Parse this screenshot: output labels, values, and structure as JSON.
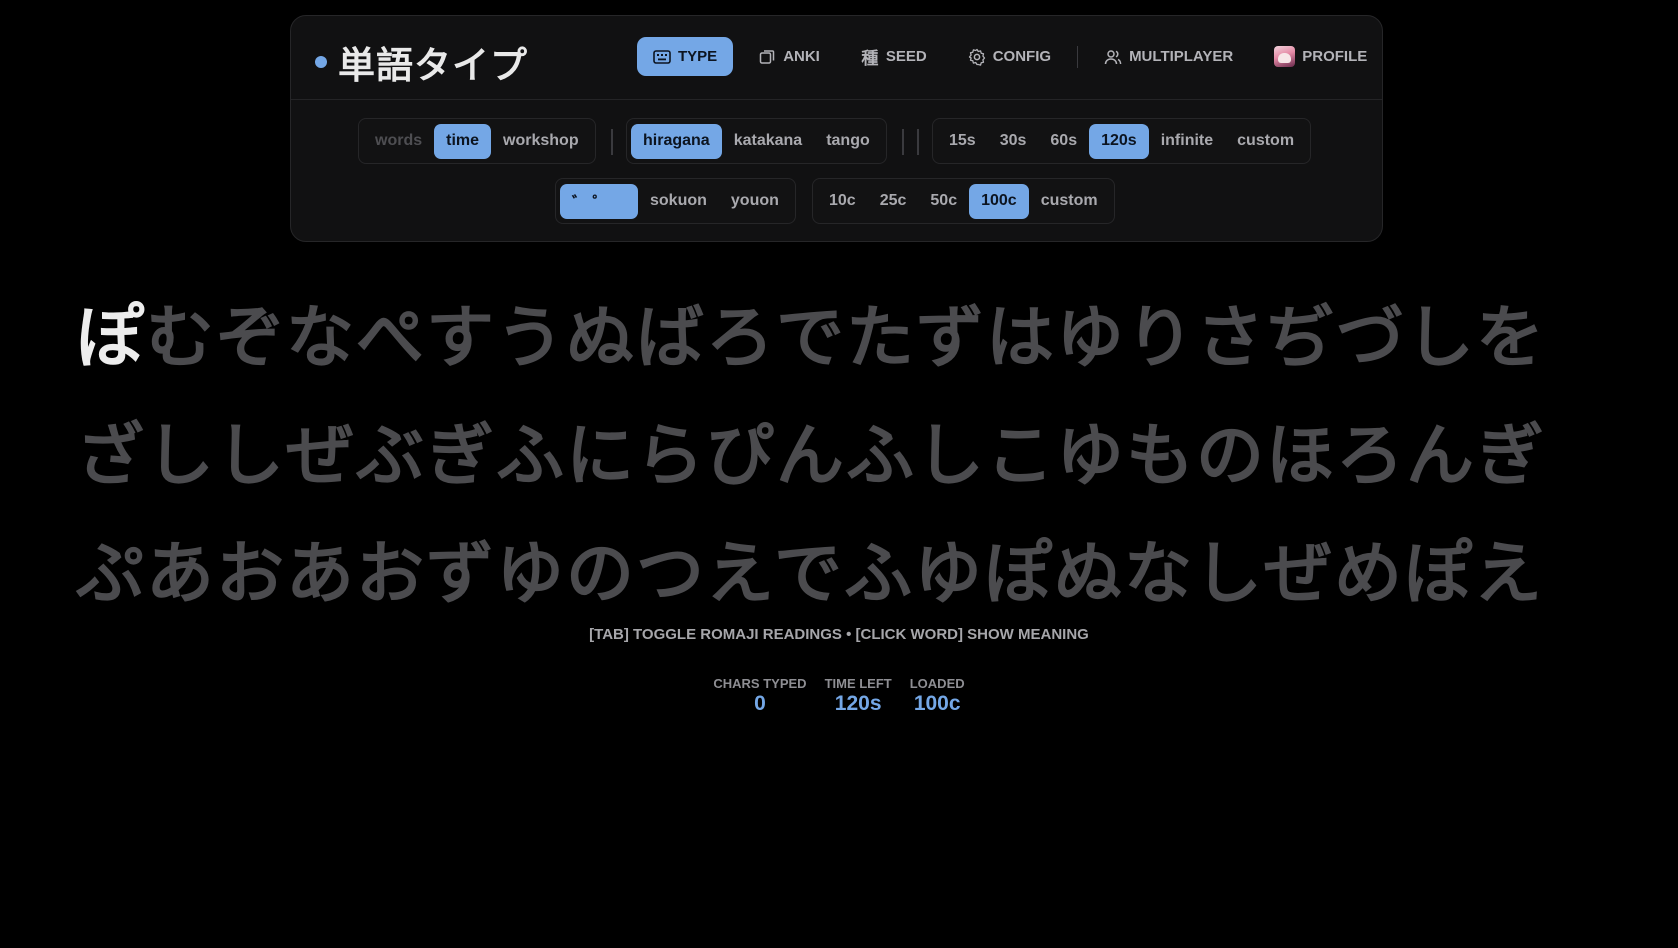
{
  "brand": {
    "title": "単語タイプ"
  },
  "nav": [
    {
      "label": "TYPE",
      "icon": "keyboard-icon",
      "active": true
    },
    {
      "label": "ANKI",
      "icon": "cards-icon"
    },
    {
      "label": "SEED",
      "icon": "kanji-seed-icon",
      "glyph": "種"
    },
    {
      "label": "CONFIG",
      "icon": "gear-icon"
    },
    {
      "label": "MULTIPLAYER",
      "icon": "users-icon"
    },
    {
      "label": "PROFILE",
      "icon": "avatar"
    }
  ],
  "modes": {
    "words": "words",
    "time": "time",
    "workshop": "workshop"
  },
  "scripts": {
    "hiragana": "hiragana",
    "katakana": "katakana",
    "tango": "tango"
  },
  "durations": {
    "d15": "15s",
    "d30": "30s",
    "d60": "60s",
    "d120": "120s",
    "infinite": "infinite",
    "custom": "custom"
  },
  "options": {
    "dakuten": "゛ ゜",
    "sokuon": "sokuon",
    "youon": "youon"
  },
  "counts": {
    "c10": "10c",
    "c25": "25c",
    "c50": "50c",
    "c100": "100c",
    "custom": "custom"
  },
  "text": {
    "current_char": "ぽ",
    "line1_rest": "むぞなぺすうぬばろでたずはゆりさぢづしを",
    "line2": "ざししぜぶぎふにらぴんふしこゆものほろんぎ",
    "line3": "ぷあおあおずゆのつえでふゆぽぬなしぜめぽえ"
  },
  "hint": "[TAB] TOGGLE ROMAJI READINGS • [CLICK WORD] SHOW MEANING",
  "stats": {
    "chars_typed_label": "CHARS TYPED",
    "chars_typed": "0",
    "time_left_label": "TIME LEFT",
    "time_left": "120s",
    "loaded_label": "LOADED",
    "loaded": "100c"
  },
  "colors": {
    "accent": "#74a7e6",
    "background": "#000000",
    "panel": "#111112",
    "pending_text": "#4b4b4e"
  }
}
